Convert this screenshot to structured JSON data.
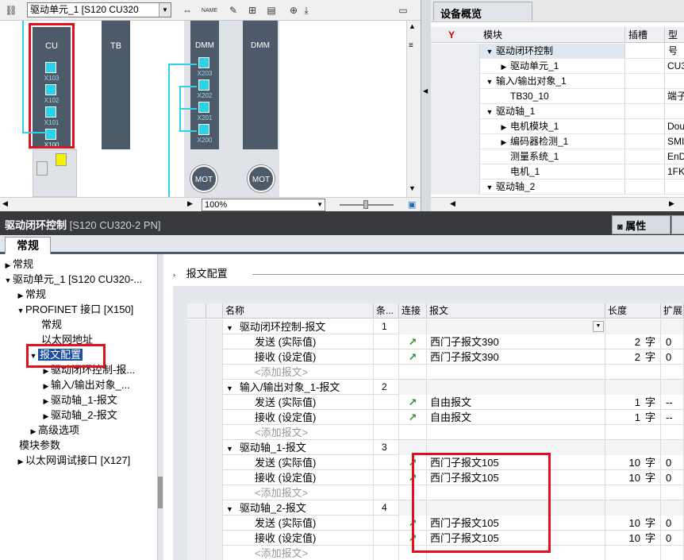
{
  "device_view": {
    "toolbar": {
      "device_selector": "驱动单元_1 [S120 CU320",
      "zoom": "100%"
    },
    "modules": [
      {
        "name": "CU",
        "ports": [
          "X103",
          "X102",
          "X101",
          "X100"
        ]
      },
      {
        "name": "TB",
        "ports": []
      },
      {
        "name": "DMM",
        "ports": [
          "X203",
          "X202",
          "X201",
          "X200"
        ]
      },
      {
        "name": "DMM",
        "ports": []
      }
    ],
    "motors": [
      "MOT",
      "MOT"
    ]
  },
  "overview": {
    "tab": "设备概览",
    "columns": [
      "模块",
      "插槽",
      "型号"
    ],
    "rows": [
      {
        "label": "驱动闭环控制",
        "level": 0,
        "arrow": "▼",
        "type": ""
      },
      {
        "label": "驱动单元_1",
        "level": 1,
        "arrow": "▶",
        "type": "CU3"
      },
      {
        "label": "输入/输出对象_1",
        "level": 0,
        "arrow": "▼",
        "type": ""
      },
      {
        "label": "TB30_10",
        "level": 1,
        "arrow": "",
        "type": "端子"
      },
      {
        "label": "驱动轴_1",
        "level": 0,
        "arrow": "▼",
        "type": ""
      },
      {
        "label": "电机模块_1",
        "level": 1,
        "arrow": "▶",
        "type": "Dou"
      },
      {
        "label": "编码器检测_1",
        "level": 1,
        "arrow": "▶",
        "type": "SMI"
      },
      {
        "label": "测量系统_1",
        "level": 1,
        "arrow": "",
        "type": "EnD"
      },
      {
        "label": "电机_1",
        "level": 1,
        "arrow": "",
        "type": "1FK"
      },
      {
        "label": "驱动轴_2",
        "level": 0,
        "arrow": "▼",
        "type": ""
      }
    ]
  },
  "properties": {
    "title": "驱动闭环控制",
    "subtitle": "[S120 CU320-2 PN]",
    "tab_properties": "属性",
    "tab_general": "常规"
  },
  "tree": [
    {
      "label": "常规",
      "indent": 0,
      "arrow": "▶"
    },
    {
      "label": "驱动单元_1 [S120 CU320-...",
      "indent": 0,
      "arrow": "▼"
    },
    {
      "label": "常规",
      "indent": 1,
      "arrow": "▶"
    },
    {
      "label": "PROFINET 接口 [X150]",
      "indent": 1,
      "arrow": "▼"
    },
    {
      "label": "常规",
      "indent": 3,
      "arrow": ""
    },
    {
      "label": "以太网地址",
      "indent": 3,
      "arrow": ""
    },
    {
      "label": "报文配置",
      "indent": 2,
      "arrow": "▼",
      "selected": true
    },
    {
      "label": "驱动闭环控制-报...",
      "indent": 3,
      "arrow": "▶"
    },
    {
      "label": "输入/输出对象_...",
      "indent": 3,
      "arrow": "▶"
    },
    {
      "label": "驱动轴_1-报文",
      "indent": 3,
      "arrow": "▶"
    },
    {
      "label": "驱动轴_2-报文",
      "indent": 3,
      "arrow": "▶"
    },
    {
      "label": "高级选项",
      "indent": 2,
      "arrow": "▶"
    },
    {
      "label": "模块参数",
      "indent": 1,
      "arrow": ""
    },
    {
      "label": "以太网调试接口 [X127]",
      "indent": 1,
      "arrow": "▶"
    }
  ],
  "section_title": "报文配置",
  "table": {
    "headers": [
      "名称",
      "条...",
      "连接",
      "报文",
      "长度",
      "扩展"
    ],
    "rows": [
      {
        "kind": "grp",
        "name": "驱动闭环控制-报文",
        "no": "1",
        "link": false,
        "telegram": "",
        "len": "",
        "unit": "",
        "ext": ""
      },
      {
        "kind": "sub",
        "name": "发送 (实际值)",
        "no": "",
        "link": true,
        "telegram": "西门子报文390",
        "len": "2",
        "unit": "字",
        "ext": "0"
      },
      {
        "kind": "sub",
        "name": "接收 (设定值)",
        "no": "",
        "link": true,
        "telegram": "西门子报文390",
        "len": "2",
        "unit": "字",
        "ext": "0"
      },
      {
        "kind": "add",
        "name": "<添加报文>",
        "no": "",
        "link": false,
        "telegram": "",
        "len": "",
        "unit": "",
        "ext": ""
      },
      {
        "kind": "grp",
        "name": "输入/输出对象_1-报文",
        "no": "2",
        "link": false,
        "telegram": "",
        "len": "",
        "unit": "",
        "ext": ""
      },
      {
        "kind": "sub",
        "name": "发送 (实际值)",
        "no": "",
        "link": true,
        "telegram": "自由报文",
        "len": "1",
        "unit": "字",
        "ext": "--"
      },
      {
        "kind": "sub",
        "name": "接收 (设定值)",
        "no": "",
        "link": true,
        "telegram": "自由报文",
        "len": "1",
        "unit": "字",
        "ext": "--"
      },
      {
        "kind": "add",
        "name": "<添加报文>",
        "no": "",
        "link": false,
        "telegram": "",
        "len": "",
        "unit": "",
        "ext": ""
      },
      {
        "kind": "grp",
        "name": "驱动轴_1-报文",
        "no": "3",
        "link": false,
        "telegram": "",
        "len": "",
        "unit": "",
        "ext": ""
      },
      {
        "kind": "sub",
        "name": "发送 (实际值)",
        "no": "",
        "link": true,
        "telegram": "西门子报文105",
        "len": "10",
        "unit": "字",
        "ext": "0"
      },
      {
        "kind": "sub",
        "name": "接收 (设定值)",
        "no": "",
        "link": true,
        "telegram": "西门子报文105",
        "len": "10",
        "unit": "字",
        "ext": "0"
      },
      {
        "kind": "add",
        "name": "<添加报文>",
        "no": "",
        "link": false,
        "telegram": "",
        "len": "",
        "unit": "",
        "ext": ""
      },
      {
        "kind": "grp",
        "name": "驱动轴_2-报文",
        "no": "4",
        "link": false,
        "telegram": "",
        "len": "",
        "unit": "",
        "ext": ""
      },
      {
        "kind": "sub",
        "name": "发送 (实际值)",
        "no": "",
        "link": true,
        "telegram": "西门子报文105",
        "len": "10",
        "unit": "字",
        "ext": "0"
      },
      {
        "kind": "sub",
        "name": "接收 (设定值)",
        "no": "",
        "link": true,
        "telegram": "西门子报文105",
        "len": "10",
        "unit": "字",
        "ext": "0"
      },
      {
        "kind": "add",
        "name": "<添加报文>",
        "no": "",
        "link": false,
        "telegram": "",
        "len": "",
        "unit": "",
        "ext": ""
      }
    ]
  },
  "colors": {
    "highlight": "#e0101c",
    "module": "#4d5a69",
    "port": "#2ad3e8",
    "header_dark": "#37393d"
  }
}
